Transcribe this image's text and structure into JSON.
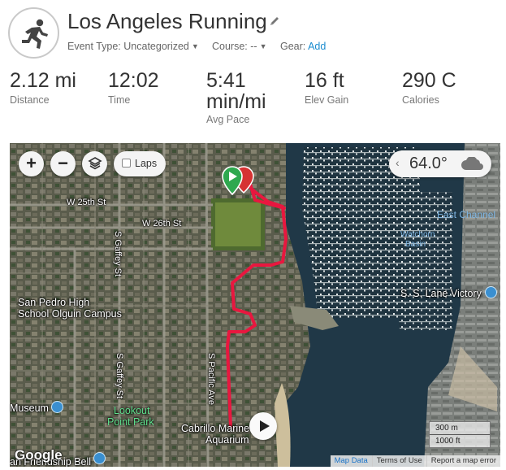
{
  "header": {
    "title": "Los Angeles Running",
    "event_type_label": "Event Type:",
    "event_type_value": "Uncategorized",
    "course_label": "Course:",
    "course_value": "--",
    "gear_label": "Gear:",
    "gear_action": "Add",
    "activity_icon": "runner-icon",
    "edit_icon": "pencil-icon"
  },
  "stats": [
    {
      "value": "2.12 mi",
      "label": "Distance"
    },
    {
      "value": "12:02",
      "label": "Time"
    },
    {
      "value": "5:41",
      "value2": "min/mi",
      "label": "Avg Pace"
    },
    {
      "value": "16 ft",
      "label": "Elev Gain"
    },
    {
      "value": "290 C",
      "label": "Calories"
    }
  ],
  "map": {
    "controls": {
      "zoom_in": "+",
      "zoom_out": "−",
      "layers_icon": "layers-icon",
      "laps_label": "Laps",
      "laps_checked": false
    },
    "weather": {
      "temp": "64.0°",
      "icon": "cloud-icon"
    },
    "labels": {
      "w25": "W 25th St",
      "w26": "W 26th St",
      "gaffey1": "S Gaffey St",
      "gaffey2": "S Gaffey St",
      "pacific": "S Pacific Ave",
      "school1": "San Pedro High",
      "school2": "School Olguin Campus",
      "museum": "Museum",
      "lookout1": "Lookout",
      "lookout2": "Point Park",
      "cabrillo1": "Cabrillo Marine",
      "cabrillo2": "Aquarium",
      "east_channel": "East Channel",
      "watchorn1": "Watchorn",
      "watchorn2": "Basin",
      "ss_lane": "S. S. Lane Victory",
      "friendship": "an Friendship Bell"
    },
    "scale": {
      "metric": "300 m",
      "imperial": "1000 ft"
    },
    "attribution": {
      "google": "Google",
      "map_data": "Map Data",
      "terms": "Terms of Use",
      "report": "Report a map error"
    },
    "colors": {
      "route": "#e8173f",
      "start": "#2fa84f",
      "end": "#d63333"
    }
  }
}
